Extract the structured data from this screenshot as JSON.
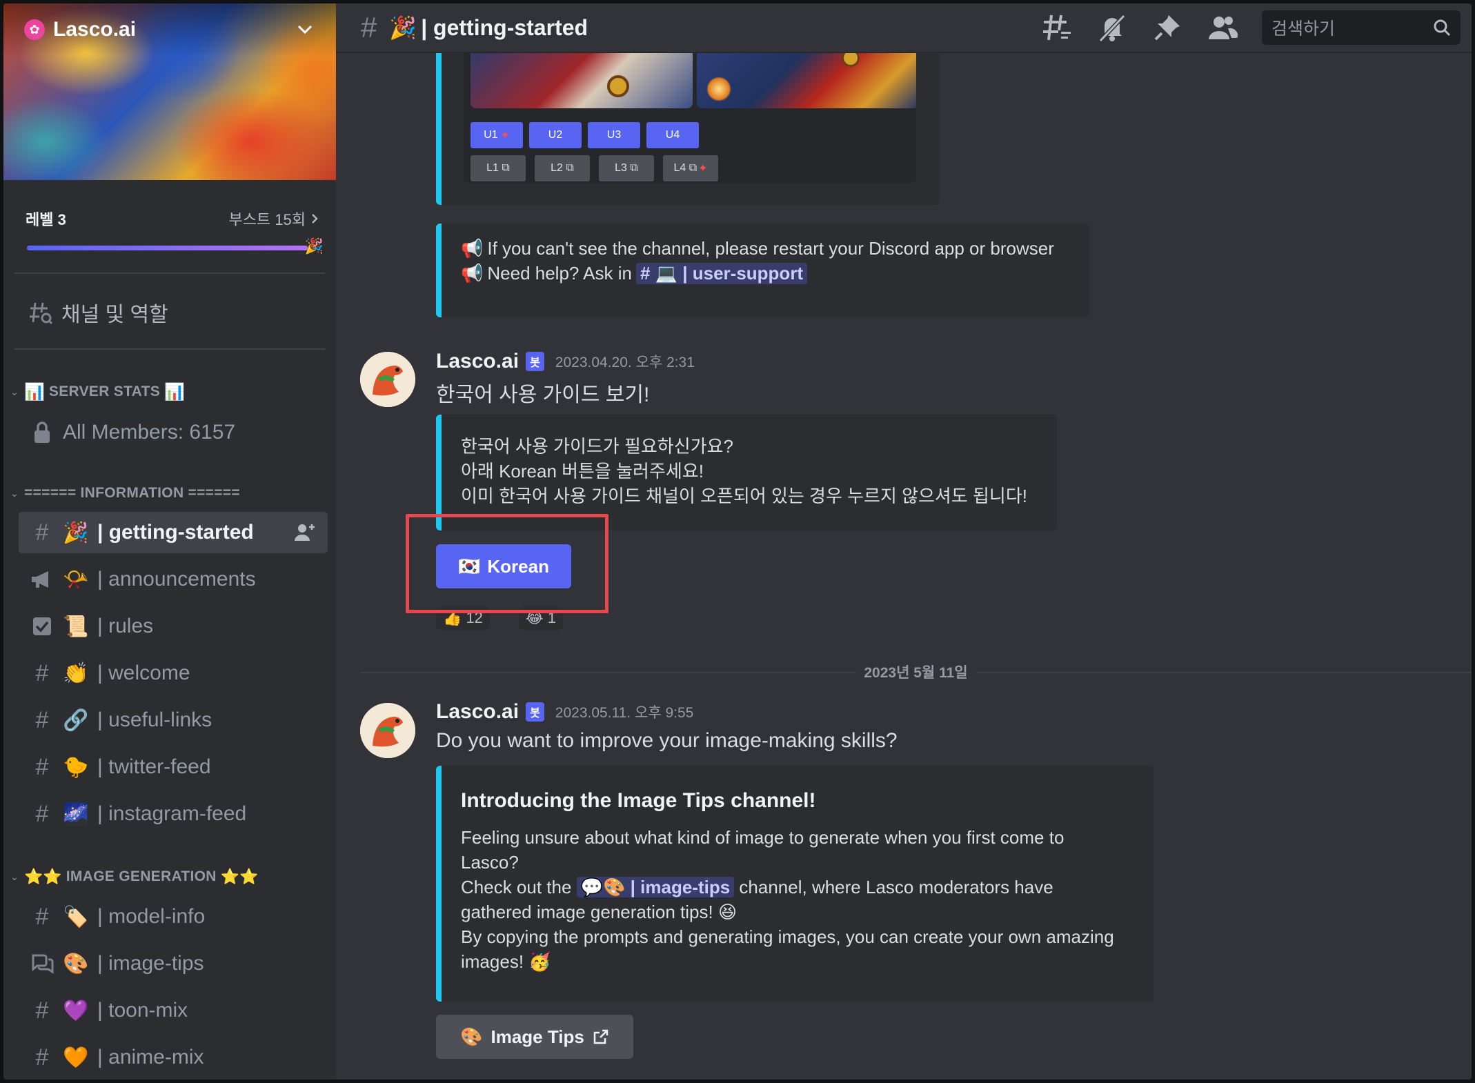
{
  "server": {
    "name": "Lasco.ai",
    "level_label": "레벨 3",
    "boost_label": "부스트 15회",
    "boost_progress": 0.97
  },
  "sidebar": {
    "browse_label": "채널 및 역할",
    "categories": [
      {
        "label": "SERVER STATS",
        "icon": "📊"
      },
      {
        "label": "====== INFORMATION ======"
      },
      {
        "label": "IMAGE GENERATION",
        "icon": "⭐⭐"
      }
    ],
    "stats_channel": "All Members: 6157",
    "channels": [
      {
        "emoji": "🎉",
        "name": "| getting-started",
        "icon": "hash"
      },
      {
        "emoji": "📯",
        "name": "| announcements",
        "icon": "megaphone"
      },
      {
        "emoji": "📜",
        "name": "| rules",
        "icon": "checkbox"
      },
      {
        "emoji": "👏",
        "name": "| welcome",
        "icon": "hash"
      },
      {
        "emoji": "🔗",
        "name": "| useful-links",
        "icon": "hash"
      },
      {
        "emoji": "🐤",
        "name": "| twitter-feed",
        "icon": "hash"
      },
      {
        "emoji": "🌌",
        "name": "| instagram-feed",
        "icon": "hash"
      },
      {
        "emoji": "🏷️",
        "name": "| model-info",
        "icon": "hash"
      },
      {
        "emoji": "🎨",
        "name": "| image-tips",
        "icon": "forum"
      },
      {
        "emoji": "💜",
        "name": "| toon-mix",
        "icon": "hash"
      },
      {
        "emoji": "🧡",
        "name": "| anime-mix",
        "icon": "hash"
      }
    ]
  },
  "topbar": {
    "channel_emoji": "🎉",
    "channel_title": "| getting-started",
    "search_placeholder": "검색하기"
  },
  "upscale_buttons": [
    "U1",
    "U2",
    "U3",
    "U4"
  ],
  "link_buttons": [
    "L1",
    "L2",
    "L3",
    "L4"
  ],
  "notice": {
    "line1": "If you can't see the channel, please restart your Discord app or browser",
    "line2_prefix": "Need help? Ask in",
    "mention_channel": "| user-support"
  },
  "message1": {
    "author": "Lasco.ai",
    "bot_tag": "봇",
    "timestamp": "2023.04.20. 오후 2:31",
    "text": "한국어 사용 가이드 보기!",
    "embed_lines": [
      "한국어 사용 가이드가 필요하신가요?",
      "아래 Korean 버튼을 눌러주세요!",
      "이미 한국어 사용 가이드 채널이 오픈되어 있는 경우 누르지 않으셔도 됩니다!"
    ],
    "button_label": "Korean",
    "button_emoji": "🇰🇷",
    "reactions": [
      {
        "emoji": "👍",
        "count": "12"
      },
      {
        "emoji": "😂",
        "count": "1"
      }
    ]
  },
  "date_divider": "2023년 5월 11일",
  "message2": {
    "author": "Lasco.ai",
    "bot_tag": "봇",
    "timestamp": "2023.05.11. 오후 9:55",
    "text": "Do you want to improve your image-making skills?",
    "embed_title": "Introducing the Image Tips channel!",
    "embed_line1": "Feeling unsure about what kind of image to generate when you first come to",
    "embed_line2": "Lasco?",
    "embed_line3_prefix": "Check out the",
    "embed_mention": "| image-tips",
    "embed_line3_suffix": "channel, where Lasco moderators have",
    "embed_line4": "gathered image generation tips!",
    "embed_line5": "By copying the prompts and generating images, you can create your own amazing",
    "embed_line6": "images!",
    "button_label": "Image Tips",
    "button_emoji": "🎨"
  },
  "colors": {
    "accent": "#5865f2",
    "embed_border": "#1ec8f0",
    "highlight": "#e5484d"
  }
}
